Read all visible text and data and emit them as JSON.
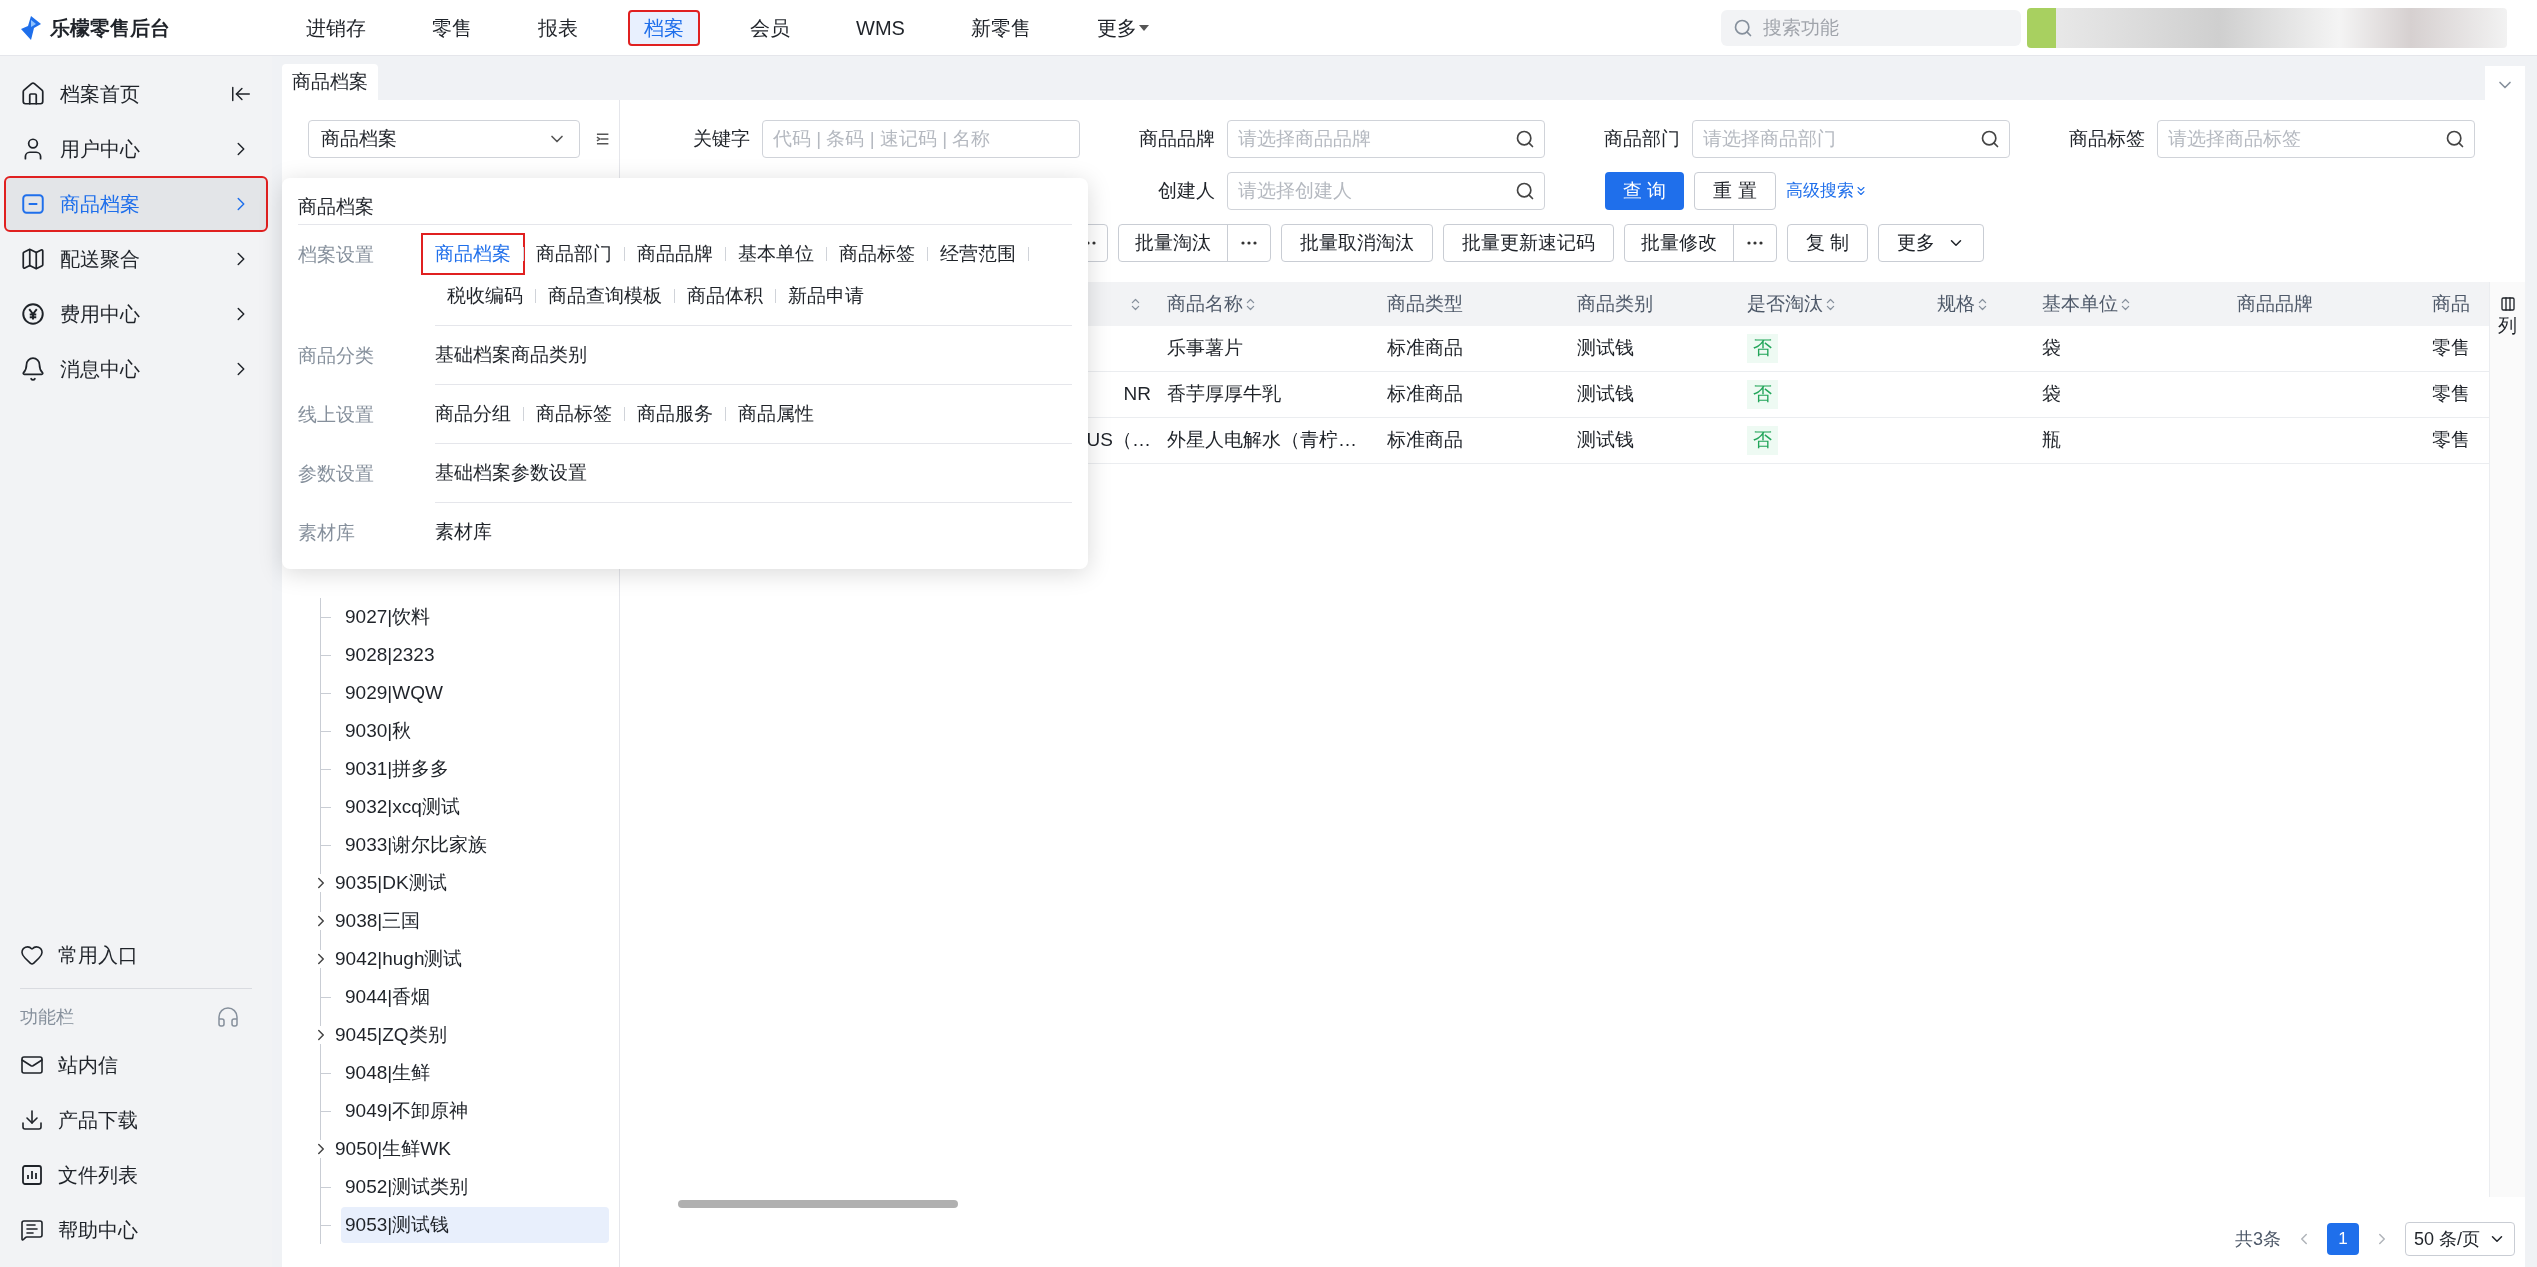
{
  "app": {
    "title": "乐檬零售后台"
  },
  "top_nav": [
    {
      "label": "进销存",
      "selected": false,
      "highlighted": false,
      "dropdown": false
    },
    {
      "label": "零售",
      "selected": false,
      "highlighted": false,
      "dropdown": false
    },
    {
      "label": "报表",
      "selected": false,
      "highlighted": false,
      "dropdown": false
    },
    {
      "label": "档案",
      "selected": true,
      "highlighted": true,
      "dropdown": false
    },
    {
      "label": "会员",
      "selected": false,
      "highlighted": false,
      "dropdown": false
    },
    {
      "label": "WMS",
      "selected": false,
      "highlighted": false,
      "dropdown": false
    },
    {
      "label": "新零售",
      "selected": false,
      "highlighted": false,
      "dropdown": false
    },
    {
      "label": "更多",
      "selected": false,
      "highlighted": false,
      "dropdown": true
    }
  ],
  "search": {
    "placeholder": "搜索功能"
  },
  "sidebar": {
    "items": [
      {
        "label": "档案首页",
        "kind": "collapse",
        "selected": false,
        "highlighted": false
      },
      {
        "label": "用户中心",
        "kind": "submenu",
        "selected": false,
        "highlighted": false
      },
      {
        "label": "商品档案",
        "kind": "submenu",
        "selected": true,
        "highlighted": true
      },
      {
        "label": "配送聚合",
        "kind": "submenu",
        "selected": false,
        "highlighted": false
      },
      {
        "label": "费用中心",
        "kind": "submenu",
        "selected": false,
        "highlighted": false
      },
      {
        "label": "消息中心",
        "kind": "submenu",
        "selected": false,
        "highlighted": false
      }
    ],
    "favorites": "常用入口",
    "toolbar_title": "功能栏",
    "tools": [
      "站内信",
      "产品下载",
      "文件列表",
      "帮助中心"
    ]
  },
  "tabs": [
    {
      "label": "商品档案",
      "selected": true
    }
  ],
  "tree": {
    "select": {
      "value": "商品档案"
    },
    "items": [
      {
        "label": "9027|饮料",
        "expandable": false,
        "selected": false
      },
      {
        "label": "9028|2323",
        "expandable": false,
        "selected": false
      },
      {
        "label": "9029|WQW",
        "expandable": false,
        "selected": false
      },
      {
        "label": "9030|秋",
        "expandable": false,
        "selected": false
      },
      {
        "label": "9031|拼多多",
        "expandable": false,
        "selected": false
      },
      {
        "label": "9032|xcq测试",
        "expandable": false,
        "selected": false
      },
      {
        "label": "9033|谢尔比家族",
        "expandable": false,
        "selected": false
      },
      {
        "label": "9035|DK测试",
        "expandable": true,
        "selected": false
      },
      {
        "label": "9038|三国",
        "expandable": true,
        "selected": false
      },
      {
        "label": "9042|hugh测试",
        "expandable": true,
        "selected": false
      },
      {
        "label": "9044|香烟",
        "expandable": false,
        "selected": false
      },
      {
        "label": "9045|ZQ类别",
        "expandable": true,
        "selected": false
      },
      {
        "label": "9048|生鲜",
        "expandable": false,
        "selected": false
      },
      {
        "label": "9049|不卸原神",
        "expandable": false,
        "selected": false
      },
      {
        "label": "9050|生鲜WK",
        "expandable": true,
        "selected": false
      },
      {
        "label": "9052|测试类别",
        "expandable": false,
        "selected": false
      },
      {
        "label": "9053|测试钱",
        "expandable": false,
        "selected": true
      }
    ]
  },
  "filters": [
    {
      "label": "关键字",
      "placeholder": "代码 | 条码 | 速记码 | 名称",
      "kind": "text"
    },
    {
      "label": "商品品牌",
      "placeholder": "请选择商品品牌",
      "kind": "search"
    },
    {
      "label": "商品部门",
      "placeholder": "请选择商品部门",
      "kind": "search"
    },
    {
      "label": "商品标签",
      "placeholder": "请选择商品标签",
      "kind": "search"
    },
    {
      "label": "创建人",
      "placeholder": "请选择创建人",
      "kind": "search"
    }
  ],
  "filter_actions": {
    "query": "查 询",
    "reset": "重 置",
    "advanced": "高级搜索"
  },
  "toolbar": [
    {
      "label": "批量淘汰",
      "split": true,
      "dropdown": false
    },
    {
      "label": "批量取消淘汰",
      "split": false,
      "dropdown": false
    },
    {
      "label": "批量更新速记码",
      "split": false,
      "dropdown": false
    },
    {
      "label": "批量修改",
      "split": true,
      "dropdown": false
    },
    {
      "label": "复 制",
      "split": false,
      "dropdown": false
    },
    {
      "label": "更多",
      "split": false,
      "dropdown": true
    }
  ],
  "table": {
    "columns": [
      {
        "sortable": true
      },
      {
        "label": "商品名称",
        "sortable": true
      },
      {
        "label": "商品类型",
        "sortable": false
      },
      {
        "label": "商品类别",
        "sortable": false
      },
      {
        "label": "是否淘汰",
        "sortable": true
      },
      {
        "label": "规格",
        "sortable": true
      },
      {
        "label": "基本单位",
        "sortable": true
      },
      {
        "label": "商品品牌",
        "sortable": false
      },
      {
        "label": "商品",
        "sortable": false
      }
    ],
    "rows": [
      {
        "name": "乐事薯片",
        "type": "标准商品",
        "category": "测试钱",
        "discontinued": "否",
        "unit": "袋",
        "column_9": "零售"
      },
      {
        "column_1": "NR",
        "name": "香芋厚厚牛乳",
        "type": "标准商品",
        "category": "测试钱",
        "discontinued": "否",
        "unit": "袋",
        "column_9": "零售"
      },
      {
        "column_1": "US（…",
        "name": "外星人电解水（青柠…",
        "type": "标准商品",
        "category": "测试钱",
        "discontinued": "否",
        "unit": "瓶",
        "column_9": "零售"
      }
    ],
    "column_settings": "列"
  },
  "pagination": {
    "total": "共3条",
    "pages": [
      {
        "label": "1",
        "selected": true
      }
    ],
    "page_size": "50 条/页"
  },
  "menu": {
    "title": "商品档案",
    "sections": [
      {
        "label": "档案设置",
        "links": [
          {
            "label": "商品档案",
            "selected": true,
            "highlighted": true
          },
          {
            "label": "商品部门",
            "selected": false,
            "highlighted": false
          },
          {
            "label": "商品品牌",
            "selected": false,
            "highlighted": false
          },
          {
            "label": "基本单位",
            "selected": false,
            "highlighted": false
          },
          {
            "label": "商品标签",
            "selected": false,
            "highlighted": false
          },
          {
            "label": "经营范围",
            "selected": false,
            "highlighted": false
          },
          {
            "label": "税收编码",
            "selected": false,
            "highlighted": false
          },
          {
            "label": "商品查询模板",
            "selected": false,
            "highlighted": false
          },
          {
            "label": "商品体积",
            "selected": false,
            "highlighted": false
          },
          {
            "label": "新品申请",
            "selected": false,
            "highlighted": false
          }
        ]
      },
      {
        "label": "商品分类",
        "links": [
          {
            "label": "基础档案商品类别",
            "selected": false,
            "highlighted": false
          }
        ]
      },
      {
        "label": "线上设置",
        "links": [
          {
            "label": "商品分组",
            "selected": false,
            "highlighted": false
          },
          {
            "label": "商品标签",
            "selected": false,
            "highlighted": false
          },
          {
            "label": "商品服务",
            "selected": false,
            "highlighted": false
          },
          {
            "label": "商品属性",
            "selected": false,
            "highlighted": false
          }
        ]
      },
      {
        "label": "参数设置",
        "links": [
          {
            "label": "基础档案参数设置",
            "selected": false,
            "highlighted": false
          }
        ]
      },
      {
        "label": "素材库",
        "links": [
          {
            "label": "素材库",
            "selected": false,
            "highlighted": false
          }
        ]
      }
    ]
  }
}
